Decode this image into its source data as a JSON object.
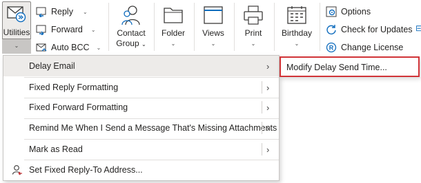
{
  "ribbon": {
    "utilities_label": "Utilities",
    "reply_label": "Reply",
    "forward_label": "Forward",
    "auto_bcc_label": "Auto BCC",
    "contact_group_line1": "Contact",
    "contact_group_line2": "Group",
    "folder_label": "Folder",
    "views_label": "Views",
    "print_label": "Print",
    "birthday_label": "Birthday",
    "options_label": "Options",
    "check_updates_label": "Check for Updates",
    "change_license_label": "Change License"
  },
  "menu": {
    "items": [
      {
        "label": "Delay Email"
      },
      {
        "label": "Fixed Reply Formatting"
      },
      {
        "label": "Fixed Forward Formatting"
      },
      {
        "label": "Remind Me When I Send a Message That's Missing Attachments"
      },
      {
        "label": "Mark as Read"
      },
      {
        "label": "Set Fixed Reply-To Address..."
      }
    ]
  },
  "submenu": {
    "label": "Modify Delay Send Time..."
  },
  "colors": {
    "accent": "#0f6cbd",
    "highlight_border": "#d13438",
    "hover_bg": "#edebe9"
  }
}
